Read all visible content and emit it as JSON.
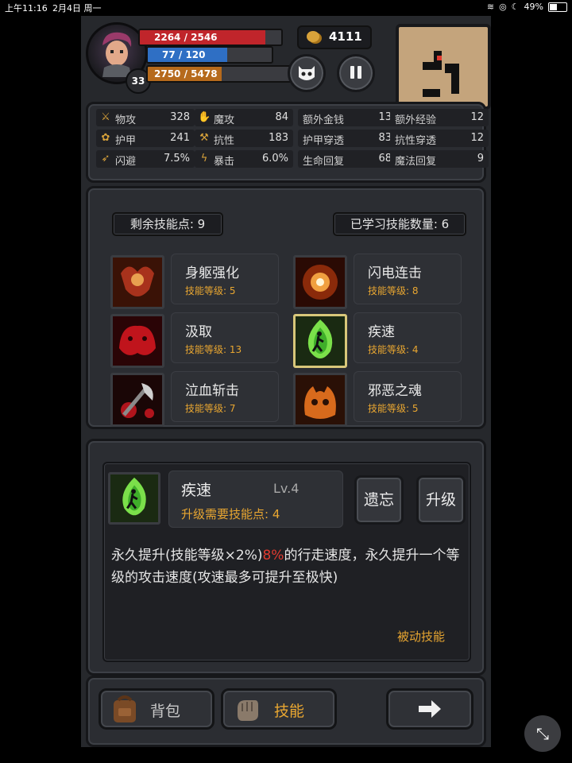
{
  "status_bar": {
    "time": "上午11:16",
    "date": "2月4日 周一",
    "battery": "49%",
    "battery_level": 0.49
  },
  "hud": {
    "level": "33",
    "hp": {
      "text": "2264 / 2546",
      "fraction": 0.889
    },
    "mp": {
      "text": "77 / 120",
      "fraction": 0.642
    },
    "xp": {
      "current": "2750",
      "sep": " / ",
      "max": "5478",
      "fraction": 0.502
    },
    "gold": "4111"
  },
  "stats": [
    {
      "icon": "sword-icon",
      "label": "物攻",
      "value": "328"
    },
    {
      "icon": "magic-hand-icon",
      "label": "魔攻",
      "value": "84"
    },
    {
      "icon": "",
      "label": "额外金钱",
      "value": "13"
    },
    {
      "icon": "",
      "label": "额外经验",
      "value": "12"
    },
    {
      "icon": "paw-armor-icon",
      "label": "护甲",
      "value": "241"
    },
    {
      "icon": "muscle-icon",
      "label": "抗性",
      "value": "183"
    },
    {
      "icon": "",
      "label": "护甲穿透",
      "value": "83"
    },
    {
      "icon": "",
      "label": "抗性穿透",
      "value": "12"
    },
    {
      "icon": "dodge-runner-icon",
      "label": "闪避",
      "value": "7.5%"
    },
    {
      "icon": "lightning-icon",
      "label": "暴击",
      "value": "6.0%"
    },
    {
      "icon": "",
      "label": "生命回复",
      "value": "68"
    },
    {
      "icon": "",
      "label": "魔法回复",
      "value": "9"
    }
  ],
  "skills_header": {
    "remaining": "剩余技能点: 9",
    "learned": "已学习技能数量: 6"
  },
  "skills": [
    {
      "name": "身躯强化",
      "level": "技能等级: 5",
      "icon": "demon-body-icon"
    },
    {
      "name": "闪电连击",
      "level": "技能等级: 8",
      "icon": "lightning-burst-icon"
    },
    {
      "name": "汲取",
      "level": "技能等级: 13",
      "icon": "blood-drain-icon"
    },
    {
      "name": "疾速",
      "level": "技能等级: 4",
      "icon": "haste-runner-icon",
      "selected": true
    },
    {
      "name": "泣血斩击",
      "level": "技能等级: 7",
      "icon": "bleeding-axe-icon"
    },
    {
      "name": "邪恶之魂",
      "level": "技能等级: 5",
      "icon": "evil-soul-icon"
    }
  ],
  "detail": {
    "name": "疾速",
    "lv": "Lv.4",
    "cost": "升级需要技能点: 4",
    "forget_label": "遗忘",
    "upgrade_label": "升级",
    "desc_part1": "永久提升(技能等级×2%)",
    "desc_highlight": "8%",
    "desc_part2": "的行走速度，永久提升一个等级的攻击速度(攻速最多可提升至极快)",
    "type": "被动技能"
  },
  "nav": {
    "bag_label": "背包",
    "skills_label": "技能"
  },
  "colors": {
    "hp": "#c0252b",
    "mp": "#2f6fc4",
    "xp": "#b66a1c",
    "gold_text": "#e8a631",
    "highlight": "#e03a2f"
  }
}
